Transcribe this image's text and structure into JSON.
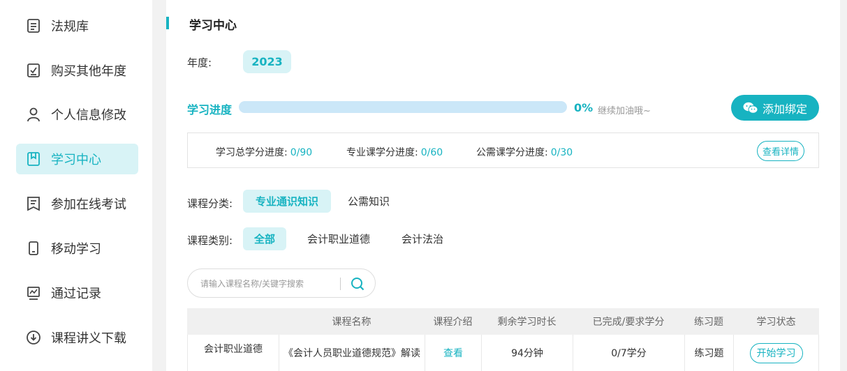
{
  "sidebar": {
    "items": [
      {
        "label": "法规库",
        "icon": "document-icon"
      },
      {
        "label": "购买其他年度",
        "icon": "checkbox-icon"
      },
      {
        "label": "个人信息修改",
        "icon": "user-icon"
      },
      {
        "label": "学习中心",
        "icon": "bookmark-icon",
        "active": true
      },
      {
        "label": "参加在线考试",
        "icon": "exam-icon"
      },
      {
        "label": "移动学习",
        "icon": "phone-icon"
      },
      {
        "label": "通过记录",
        "icon": "chart-icon"
      },
      {
        "label": "课程讲义下载",
        "icon": "download-icon"
      }
    ]
  },
  "main": {
    "title": "学习中心",
    "year": {
      "label": "年度:",
      "value": "2023"
    },
    "progress": {
      "label": "学习进度",
      "percent_text": "0%",
      "percent": 0,
      "message": "继续加油哦~"
    },
    "bind_button": "添加绑定",
    "credits": [
      {
        "label": "学习总学分进度:",
        "value": "0/90"
      },
      {
        "label": "专业课学分进度:",
        "value": "0/60"
      },
      {
        "label": "公需课学分进度:",
        "value": "0/30"
      }
    ],
    "detail_button": "查看详情",
    "category": {
      "label": "课程分类:",
      "options": [
        "专业通识知识",
        "公需知识"
      ]
    },
    "type": {
      "label": "课程类别:",
      "options": [
        "全部",
        "会计职业道德",
        "会计法治"
      ]
    },
    "search": {
      "placeholder": "请输入课程名称/关键字搜索"
    },
    "table": {
      "headers": [
        "",
        "课程名称",
        "课程介绍",
        "剩余学习时长",
        "已完成/要求学分",
        "练习题",
        "学习状态"
      ],
      "rows": [
        {
          "group": "会计职业道德",
          "name": "《会计人员职业道德规范》解读",
          "intro": "查看",
          "remaining": "94分钟",
          "credits": "0/7学分",
          "exercise": "练习题",
          "status": "开始学习"
        }
      ]
    }
  },
  "colors": {
    "accent": "#17b3c1",
    "accent_light": "#d8f3f6",
    "track": "#cbe7f8"
  }
}
